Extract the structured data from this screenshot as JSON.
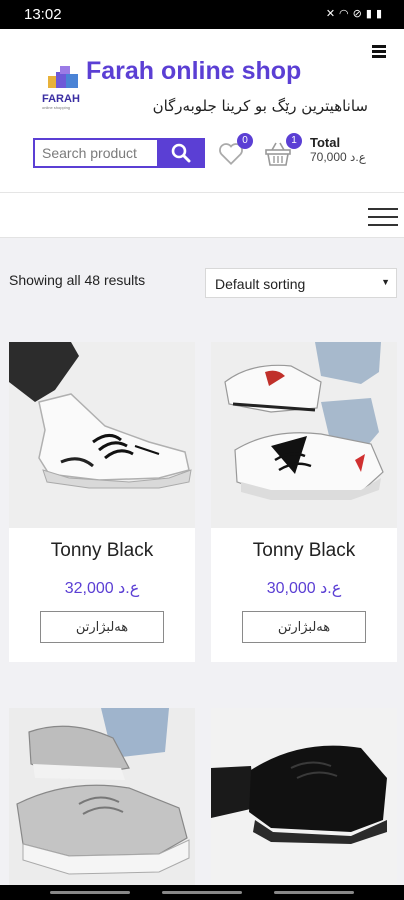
{
  "status_bar": {
    "time": "13:02"
  },
  "header": {
    "logo_text": "FARAH",
    "logo_sub": "online shopping",
    "site_title": "Farah online shop",
    "tagline": "ساناهیترین رێگ بو کرینا جلوبەرگان",
    "search_placeholder": "Search product",
    "wishlist_count": "0",
    "cart_count": "1",
    "total_label": "Total",
    "total_value": "70,000 ع.د"
  },
  "shop": {
    "results_text": "Showing all 48 results",
    "sort_selected": "Default sorting"
  },
  "products": [
    {
      "name": "Tonny Black",
      "price": "32,000 ع.د",
      "button": "هەلبژارتن"
    },
    {
      "name": "Tonny Black",
      "price": "30,000 ع.د",
      "button": "هەلبژارتن"
    }
  ],
  "colors": {
    "accent": "#5b3fd4",
    "background": "#f1f1f4",
    "text": "#222222"
  },
  "icons": [
    "search-icon",
    "heart-icon",
    "basket-icon",
    "hamburger-menu-icon"
  ]
}
